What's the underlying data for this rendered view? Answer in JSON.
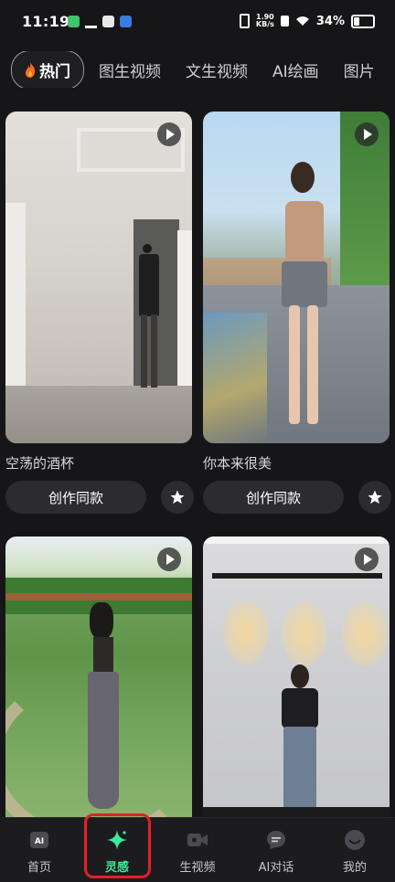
{
  "status": {
    "time": "11:19",
    "speed_value": "1.90",
    "speed_unit": "KB/s",
    "battery": "34%"
  },
  "tabs": [
    {
      "label": "热门",
      "active": true
    },
    {
      "label": "图生视频"
    },
    {
      "label": "文生视频"
    },
    {
      "label": "AI绘画"
    },
    {
      "label": "图片"
    }
  ],
  "cards": [
    {
      "title": "空荡的酒杯",
      "button": "创作同款"
    },
    {
      "title": "你本来很美",
      "button": "创作同款"
    },
    {
      "title": "",
      "button": ""
    },
    {
      "title": "",
      "button": ""
    }
  ],
  "nav": [
    {
      "label": "首页",
      "icon": "ai-home-icon"
    },
    {
      "label": "灵感",
      "icon": "sparkle-icon",
      "active": true
    },
    {
      "label": "生视频",
      "icon": "video-camera-icon"
    },
    {
      "label": "AI对话",
      "icon": "chat-bubble-icon"
    },
    {
      "label": "我的",
      "icon": "profile-icon"
    }
  ],
  "colors": {
    "accent": "#3ee89a",
    "highlight": "#e0202a",
    "background": "#161618"
  }
}
